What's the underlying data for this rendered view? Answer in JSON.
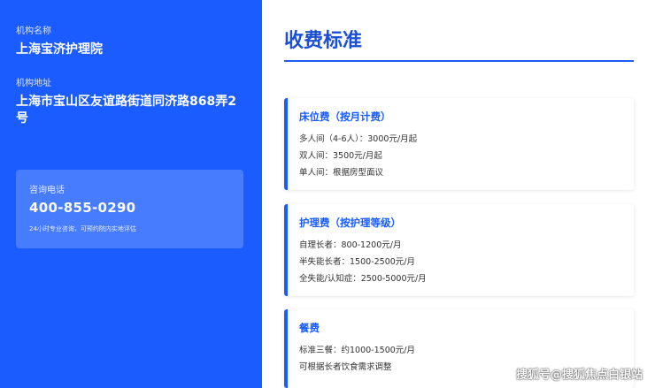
{
  "institution": {
    "name_label": "机构名称",
    "name": "上海宝济护理院",
    "address_label": "机构地址",
    "address": "上海市宝山区友谊路街道同济路868弄2号"
  },
  "contact": {
    "label": "咨询电话",
    "phone": "400-855-0290",
    "note": "24小时专业咨询，可预约院内实地评估"
  },
  "fees": {
    "title": "收费标准",
    "cards": [
      {
        "title": "床位费（按月计费）",
        "lines": [
          "多人间（4-6人）：3000元/月起",
          "双人间：3500元/月起",
          "单人间：根据房型面议"
        ]
      },
      {
        "title": "护理费（按护理等级）",
        "lines": [
          "自理长者：800-1200元/月",
          "半失能长者：1500-2500元/月",
          "全失能/认知症：2500-5000元/月"
        ]
      },
      {
        "title": "餐费",
        "lines": [
          "标准三餐：约1000-1500元/月",
          "可根据长者饮食需求调整"
        ]
      }
    ]
  },
  "watermark": "搜狐号@搜狐焦点白银站",
  "colors": {
    "primary": "#1a5cff",
    "title": "#1a4fd6"
  }
}
